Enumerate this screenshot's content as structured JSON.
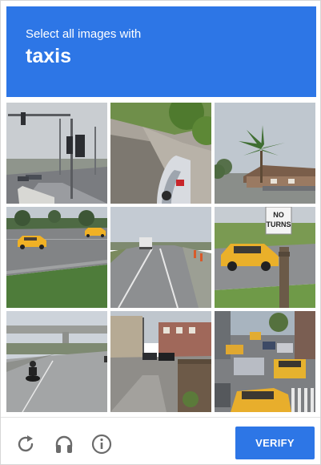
{
  "header": {
    "prompt": "Select all images with",
    "target": "taxis",
    "background": "#2d76e6"
  },
  "grid": {
    "tiles": [
      {
        "subject": "intersection with traffic lights"
      },
      {
        "subject": "sidewalk with parked car"
      },
      {
        "subject": "palm tree and houses"
      },
      {
        "subject": "highway with yellow taxis"
      },
      {
        "subject": "road with truck"
      },
      {
        "subject": "yellow taxi and no turns sign"
      },
      {
        "subject": "overpass with motorcycle"
      },
      {
        "subject": "street with parked cars"
      },
      {
        "subject": "city street with taxis"
      }
    ],
    "sign_text": "NO TURNS"
  },
  "footer": {
    "icons": [
      "reload-icon",
      "audio-icon",
      "info-icon"
    ],
    "verify_label": "VERIFY",
    "accent": "#2d76e6"
  }
}
